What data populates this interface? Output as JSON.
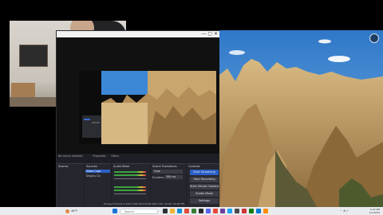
{
  "obs": {
    "docks": {
      "scenes": "Scenes",
      "sources": "Sources",
      "mixer": "Audio Mixer",
      "transitions": "Scene Transitions",
      "controls": "Controls"
    },
    "source_items": [
      "Video Capt",
      "Display Ca"
    ],
    "transition": {
      "type": "Fade",
      "duration_label": "Duration",
      "duration_value": "300 ms"
    },
    "controls": [
      "Start Streaming",
      "Start Recording",
      "Start Virtual Camera",
      "Studio Mode",
      "Settings"
    ],
    "status": "Dropped Frames 0 (0.0%)   0:00:00   0:00:00   CPU: 2.6%, 30.00 / 30.00 FPS",
    "no_source": "No source selected",
    "properties": "Properties",
    "filters": "Filters"
  },
  "taskbar": {
    "weather": "46°F",
    "search_placeholder": "Search",
    "clock_time": "5:22 PM",
    "clock_date": "1/1/2025"
  },
  "colors": {
    "accent": "#2b60c8",
    "obs_bg": "#1e1f25",
    "sky": "#2f78c8"
  }
}
